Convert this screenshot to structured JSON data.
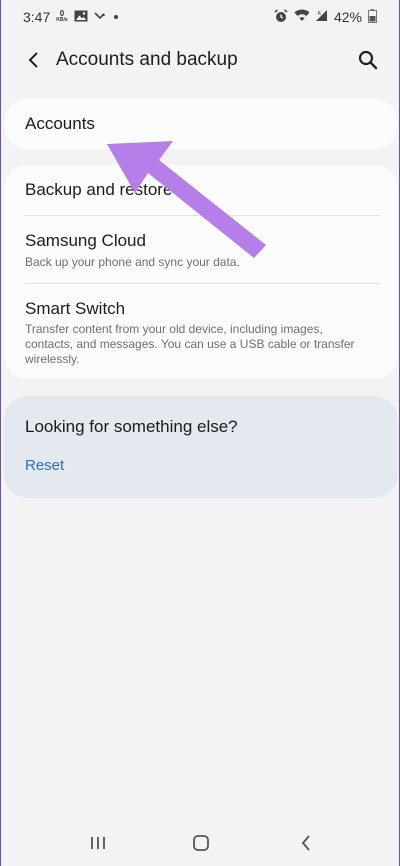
{
  "status_bar": {
    "time": "3:47",
    "net_speed": "0",
    "net_unit": "KB/s",
    "battery": "42%"
  },
  "app_bar": {
    "title": "Accounts and backup"
  },
  "sections": {
    "accounts": {
      "title": "Accounts"
    },
    "backup": {
      "items": [
        {
          "title": "Backup and restore",
          "desc": ""
        },
        {
          "title": "Samsung Cloud",
          "desc": "Back up your phone and sync your data."
        },
        {
          "title": "Smart Switch",
          "desc": "Transfer content from your old device, including images, contacts, and messages. You can use a USB cable or transfer wirelessly."
        }
      ]
    },
    "looking": {
      "title": "Looking for something else?",
      "link": "Reset"
    }
  },
  "colors": {
    "accent": "#2a6fc4",
    "arrow": "#b57ee8",
    "background": "#f4f3f4",
    "card": "#fcfcfc",
    "suggest_card": "#e3e9ef"
  },
  "icons": {
    "back": "chevron-left-icon",
    "search": "search-icon",
    "alarm": "alarm-icon",
    "wifi": "wifi-icon",
    "signal": "signal-icon",
    "battery": "battery-icon"
  }
}
